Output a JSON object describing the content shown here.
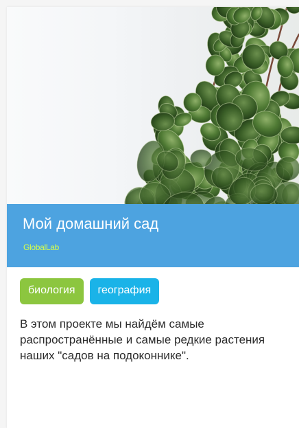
{
  "card": {
    "title": "Мой домашний сад",
    "author": "GlobalLab",
    "tags": [
      {
        "label": "биология",
        "color": "#8cc63f"
      },
      {
        "label": "география",
        "color": "#1ab3e8"
      }
    ],
    "description": "В этом проекте мы найдём самые распространённые и самые редкие растения наших \"садов на подоконнике\"."
  },
  "colors": {
    "header_background": "#4da3e0",
    "author_text": "#d7ff4a",
    "card_background": "#ffffff"
  },
  "image": {
    "subject": "potted-plant-photo"
  }
}
